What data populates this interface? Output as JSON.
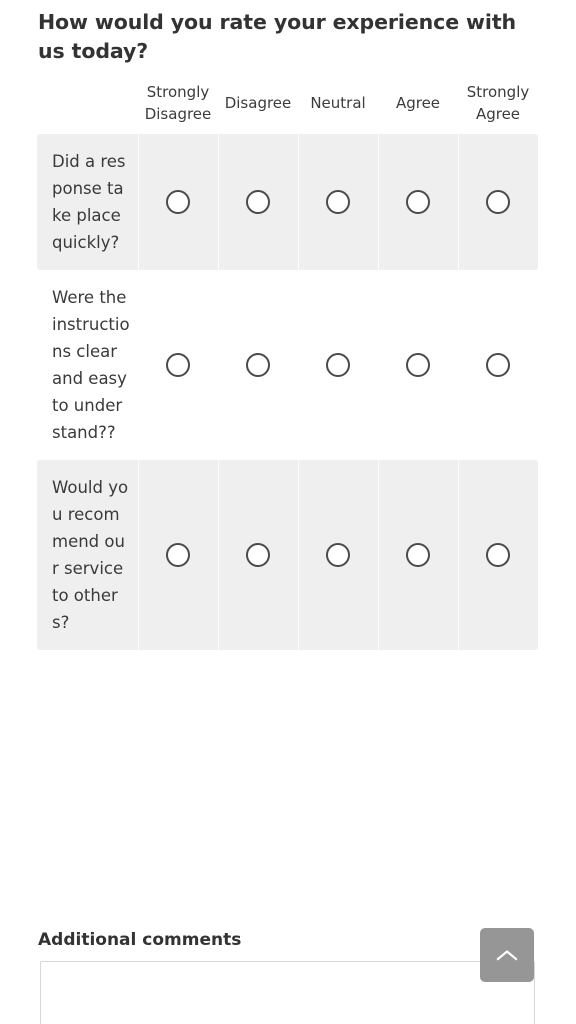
{
  "survey": {
    "title": "How would you rate your experience with us today?",
    "scale_headers": [
      "Strongly Disagree",
      "Disagree",
      "Neutral",
      "Agree",
      "Strongly Agree"
    ],
    "questions": [
      {
        "label": "Did a response take place quickly?",
        "selected": null,
        "striped": true
      },
      {
        "label": "Were the instructions clear and easy to understand??",
        "selected": null,
        "striped": false
      },
      {
        "label": "Would you recommend our service to others?",
        "selected": null,
        "striped": true
      }
    ]
  },
  "comments": {
    "label": "Additional comments",
    "value": "",
    "placeholder": ""
  },
  "scroll_top_button": {
    "icon": "chevron-up-icon",
    "label": ""
  },
  "colors": {
    "title_text": "#333333",
    "body_text": "#3a3a3a",
    "row_stripe": "#efefef",
    "radio_border": "#4a4a4a",
    "button_background": "#969696",
    "input_border": "#d8d8d8"
  }
}
